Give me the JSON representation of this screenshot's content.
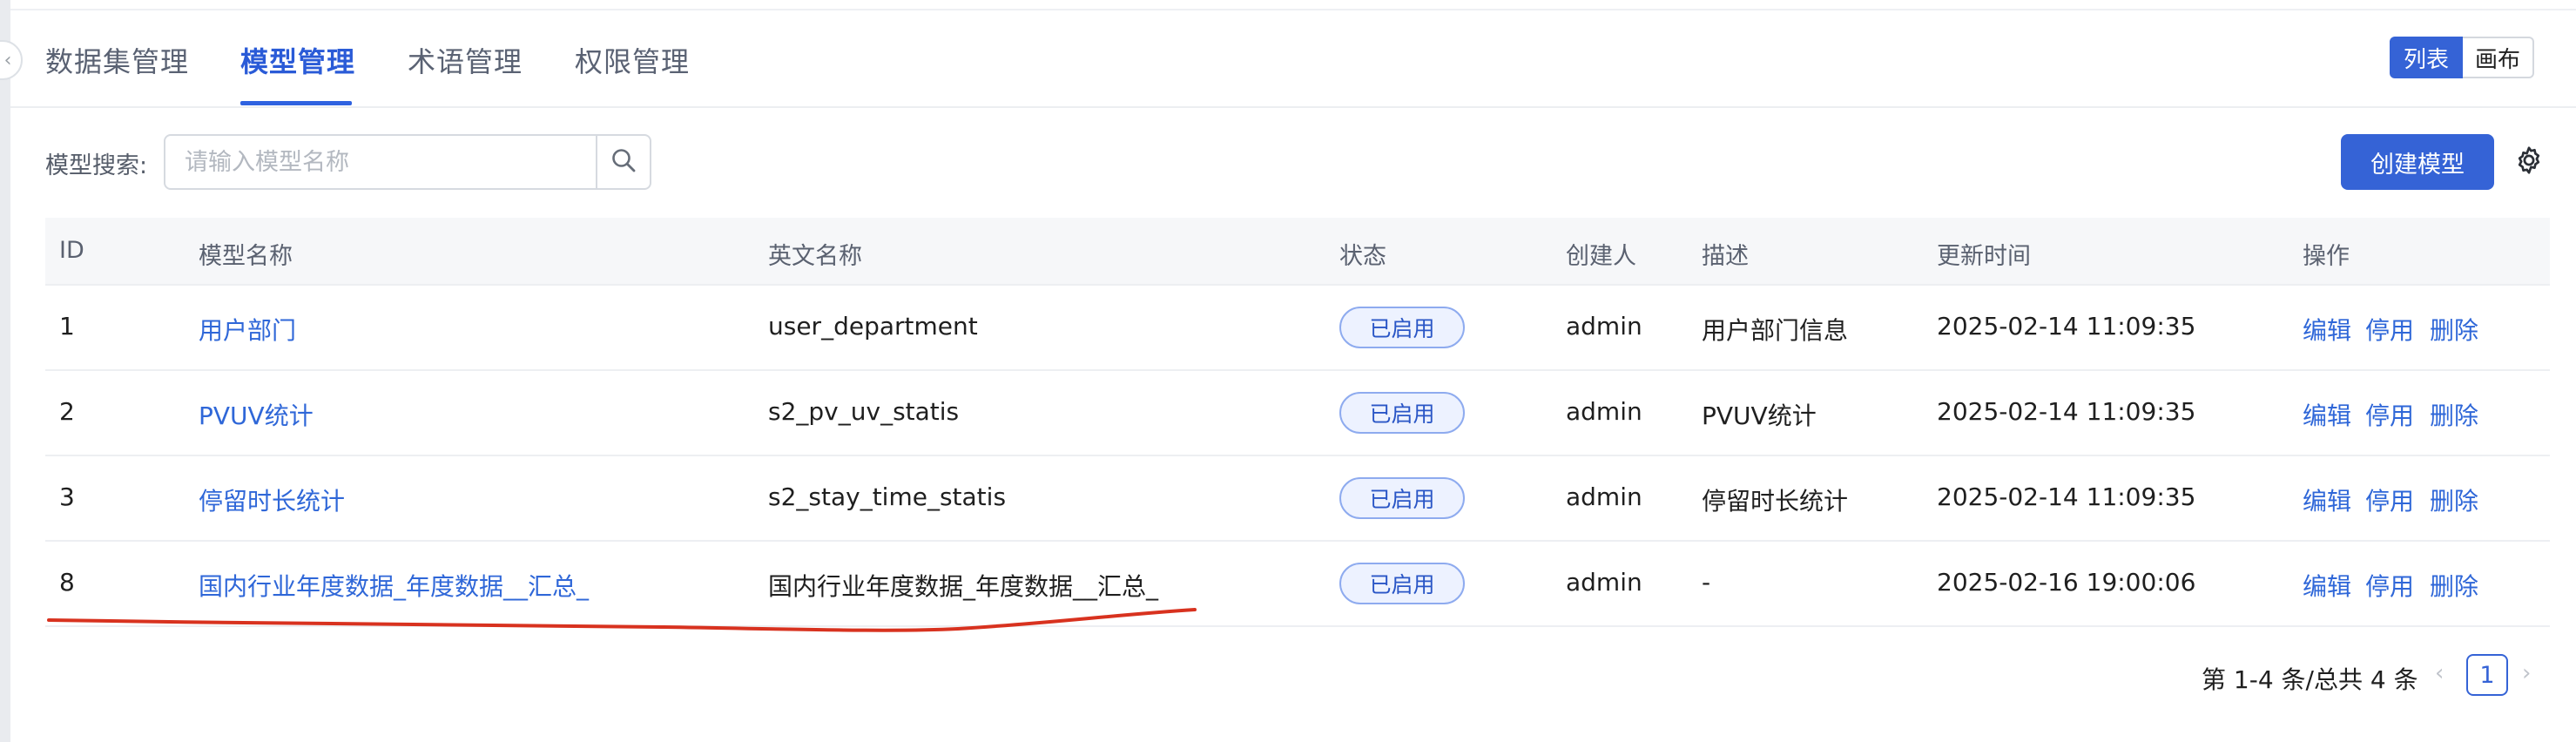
{
  "tabs": [
    {
      "label": "数据集管理",
      "active": false
    },
    {
      "label": "模型管理",
      "active": true
    },
    {
      "label": "术语管理",
      "active": false
    },
    {
      "label": "权限管理",
      "active": false
    }
  ],
  "view_toggle": {
    "list_label": "列表",
    "canvas_label": "画布",
    "selected": "列表"
  },
  "search": {
    "label": "模型搜索:",
    "placeholder": "请输入模型名称",
    "value": ""
  },
  "toolbar": {
    "create_label": "创建模型"
  },
  "icons": {
    "search": "search-icon",
    "settings": "gear-icon",
    "collapse": "chevron-left-icon"
  },
  "colors": {
    "primary": "#3563d6",
    "link": "#2f67d8",
    "badge_border": "#8eabef",
    "annotation": "#d8321f"
  },
  "table": {
    "columns": [
      "ID",
      "模型名称",
      "英文名称",
      "状态",
      "创建人",
      "描述",
      "更新时间",
      "操作"
    ],
    "rows": [
      {
        "id": "1",
        "name": "用户部门",
        "en_name": "user_department",
        "status": "已启用",
        "creator": "admin",
        "description": "用户部门信息",
        "updated": "2025-02-14 11:09:35"
      },
      {
        "id": "2",
        "name": "PVUV统计",
        "en_name": "s2_pv_uv_statis",
        "status": "已启用",
        "creator": "admin",
        "description": "PVUV统计",
        "updated": "2025-02-14 11:09:35"
      },
      {
        "id": "3",
        "name": "停留时长统计",
        "en_name": "s2_stay_time_statis",
        "status": "已启用",
        "creator": "admin",
        "description": "停留时长统计",
        "updated": "2025-02-14 11:09:35"
      },
      {
        "id": "8",
        "name": "国内行业年度数据_年度数据__汇总_",
        "en_name": "国内行业年度数据_年度数据__汇总_",
        "status": "已启用",
        "creator": "admin",
        "description": "-",
        "updated": "2025-02-16 19:00:06"
      }
    ],
    "actions": [
      "编辑",
      "停用",
      "删除"
    ]
  },
  "pagination": {
    "summary": "第 1-4 条/总共 4 条",
    "current_page": "1",
    "prev": "‹",
    "next": "›"
  }
}
